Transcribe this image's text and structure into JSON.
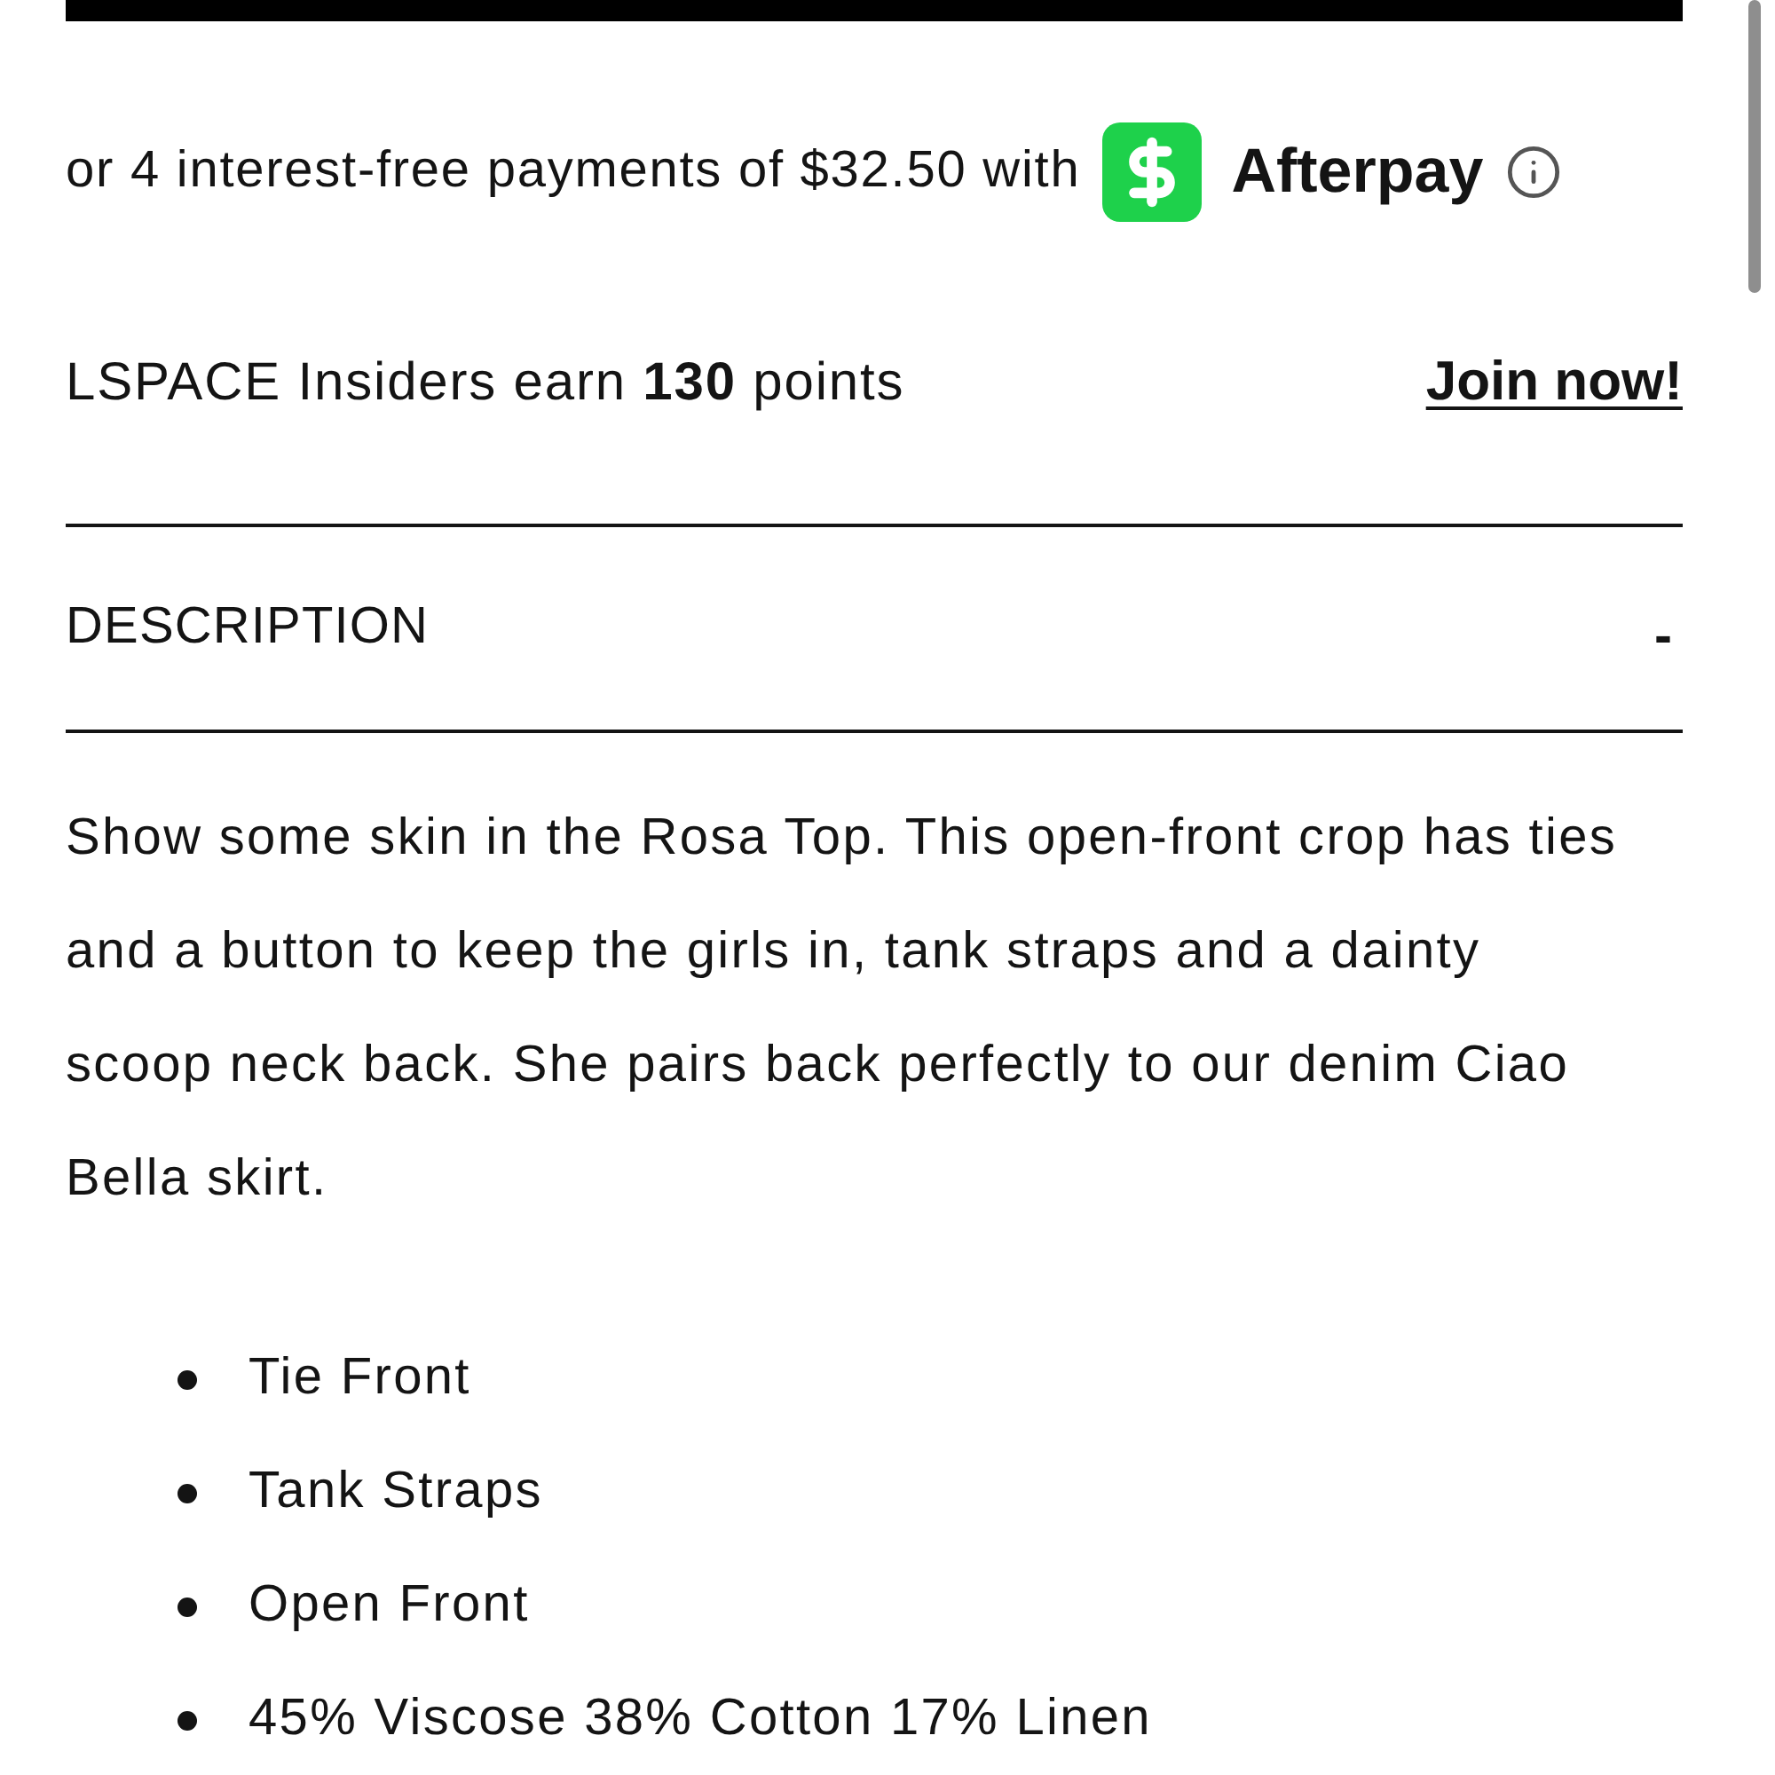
{
  "afterpay": {
    "text": "or 4 interest-free payments of $32.50 with",
    "brand": "Afterpay"
  },
  "rewards": {
    "text": "LSPACE Insiders earn **130** points",
    "link": "Join now!"
  },
  "description": {
    "title": "DESCRIPTION",
    "toggle": "-",
    "expanded": true,
    "paragraph": "Show some skin in the Rosa Top. This open-front crop has ties and a button to keep the girls in, tank straps and a dainty scoop neck back. She pairs back perfectly to our denim Ciao Bella skirt.",
    "bullets": [
      "Tie Front",
      "Tank Straps",
      "Open Front",
      "45% Viscose 38% Cotton 17% Linen"
    ]
  }
}
